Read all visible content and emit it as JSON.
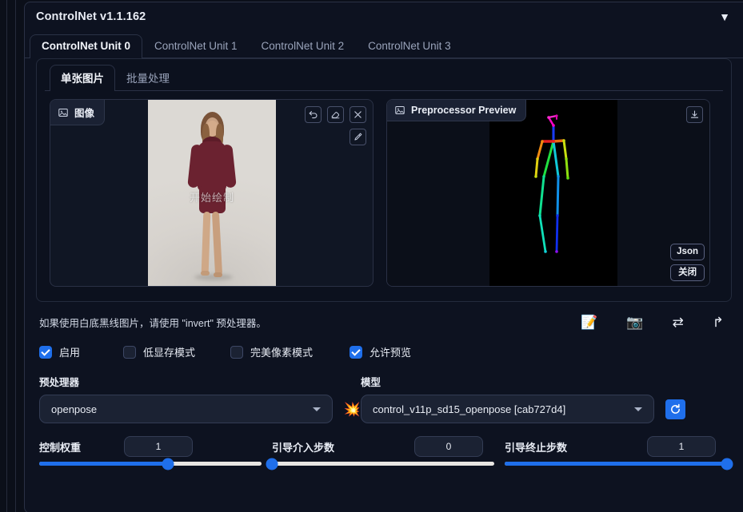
{
  "accordion": {
    "title": "ControlNet v1.1.162",
    "chevron": "▼",
    "chevron_icon_name": "chevron-down-icon"
  },
  "unit_tabs": [
    {
      "label": "ControlNet Unit 0",
      "active": true
    },
    {
      "label": "ControlNet Unit 1",
      "active": false
    },
    {
      "label": "ControlNet Unit 2",
      "active": false
    },
    {
      "label": "ControlNet Unit 3",
      "active": false
    }
  ],
  "mode_tabs": [
    {
      "label": "单张图片",
      "active": true
    },
    {
      "label": "批量处理",
      "active": false
    }
  ],
  "image_panel": {
    "tab_label": "图像",
    "watermark": "开始绘制",
    "tools": [
      {
        "name": "undo-icon",
        "title": "撤销"
      },
      {
        "name": "eraser-icon",
        "title": "橡皮擦"
      },
      {
        "name": "close-icon",
        "title": "清除"
      },
      {
        "name": "pen-icon",
        "title": "画笔"
      }
    ]
  },
  "preview_panel": {
    "tab_label": "Preprocessor Preview",
    "download_icon": "download-icon",
    "buttons": [
      {
        "label": "Json"
      },
      {
        "label": "关闭"
      }
    ]
  },
  "hint": {
    "text": "如果使用白底黑线图片，请使用 \"invert\" 预处理器。",
    "tools": [
      {
        "glyph": "📝",
        "name": "open-new-canvas-icon"
      },
      {
        "glyph": "📷",
        "name": "camera-icon"
      },
      {
        "glyph": "⇄",
        "name": "swap-camera-icon"
      },
      {
        "glyph": "↱",
        "name": "send-dimensions-icon"
      }
    ]
  },
  "checkboxes": [
    {
      "label": "启用",
      "checked": true
    },
    {
      "label": "低显存模式",
      "checked": false
    },
    {
      "label": "完美像素模式",
      "checked": false
    },
    {
      "label": "允许预览",
      "checked": true
    }
  ],
  "preprocessor": {
    "label": "预处理器",
    "value": "openpose",
    "run_glyph": "💥",
    "run_icon_name": "run-preprocessor-icon"
  },
  "model": {
    "label": "模型",
    "value": "control_v11p_sd15_openpose [cab727d4]",
    "refresh_icon_name": "refresh-icon"
  },
  "sliders": [
    {
      "label": "控制权重",
      "value": "1",
      "percent": 58
    },
    {
      "label": "引导介入步数",
      "value": "0",
      "percent": 0
    },
    {
      "label": "引导终止步数",
      "value": "1",
      "percent": 100
    }
  ],
  "colors": {
    "accent": "#1f6feb",
    "panel_bg": "#0d1220",
    "page_bg": "#0b0f19",
    "border": "#2a3145",
    "text": "#e8ecf4",
    "muted_text": "#9aa4bb"
  }
}
